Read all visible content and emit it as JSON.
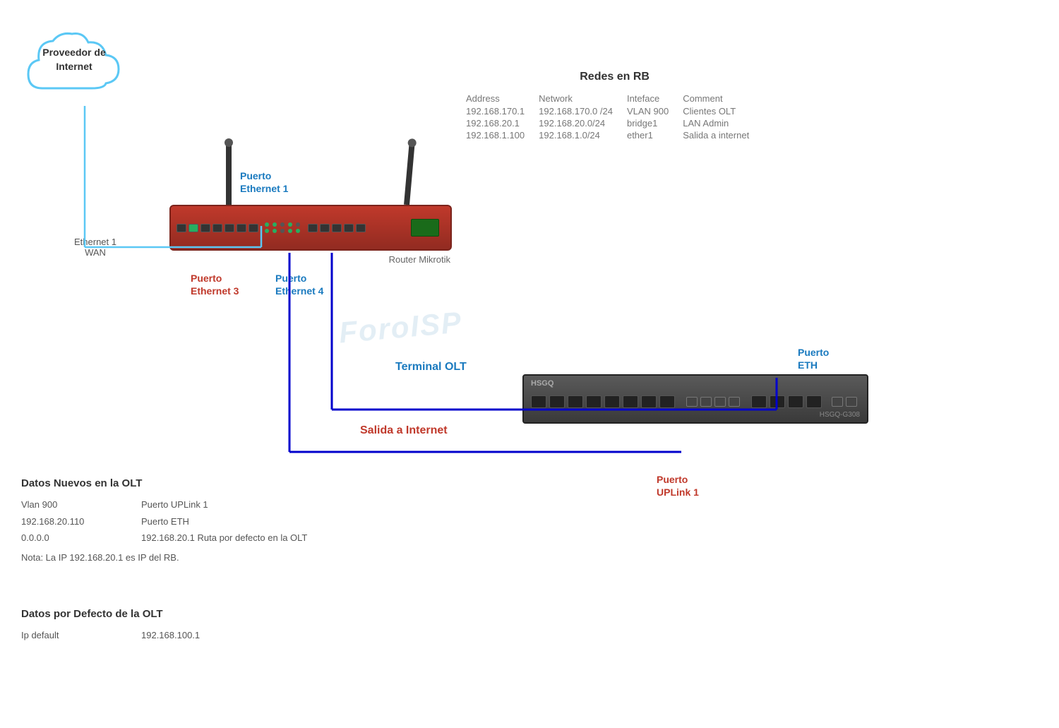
{
  "cloud": {
    "label_line1": "Proveedor de",
    "label_line2": "Internet"
  },
  "ethernet_wan": {
    "line1": "Ethernet 1",
    "line2": "WAN"
  },
  "router": {
    "label": "Router Mikrotik",
    "puerto_eth1_line1": "Puerto",
    "puerto_eth1_line2": "Ethernet 1",
    "puerto_eth3_line1": "Puerto",
    "puerto_eth3_line2": "Ethernet 3",
    "puerto_eth4_line1": "Puerto",
    "puerto_eth4_line2": "Ethernet 4"
  },
  "olt": {
    "brand": "HSGQ",
    "model": "HSGQ-G308",
    "terminal_label_line1": "Terminal OLT",
    "salida_label_line1": "Salida a Internet",
    "puerto_eth_line1": "Puerto",
    "puerto_eth_line2": "ETH",
    "puerto_uplink_line1": "Puerto",
    "puerto_uplink_line2": "UPLink 1"
  },
  "redes_rb": {
    "title": "Redes en RB",
    "headers": {
      "address": "Address",
      "network": "Network",
      "interface": "Inteface",
      "comment": "Comment"
    },
    "rows": [
      {
        "address": "192.168.170.1",
        "network": "192.168.170.0 /24",
        "interface": "VLAN 900",
        "comment": "Clientes OLT"
      },
      {
        "address": "192.168.20.1",
        "network": "192.168.20.0/24",
        "interface": "bridge1",
        "comment": "LAN Admin"
      },
      {
        "address": "192.168.1.100",
        "network": "192.168.1.0/24",
        "interface": "ether1",
        "comment": "Salida a internet"
      }
    ]
  },
  "datos_nuevos": {
    "title": "Datos Nuevos en  la OLT",
    "rows": [
      {
        "key": "Vlan 900",
        "value": "Puerto UPLink 1"
      },
      {
        "key": "192.168.20.110",
        "value": "Puerto ETH"
      },
      {
        "key": "0.0.0.0",
        "value": "192.168.20.1    Ruta  por defecto en la OLT"
      }
    ],
    "note": "Nota: La IP 192.168.20.1 es IP del RB."
  },
  "datos_defecto": {
    "title": "Datos por Defecto de la OLT",
    "rows": [
      {
        "key": "Ip default",
        "value": "192.168.100.1"
      }
    ]
  },
  "watermark": "ForoISP"
}
